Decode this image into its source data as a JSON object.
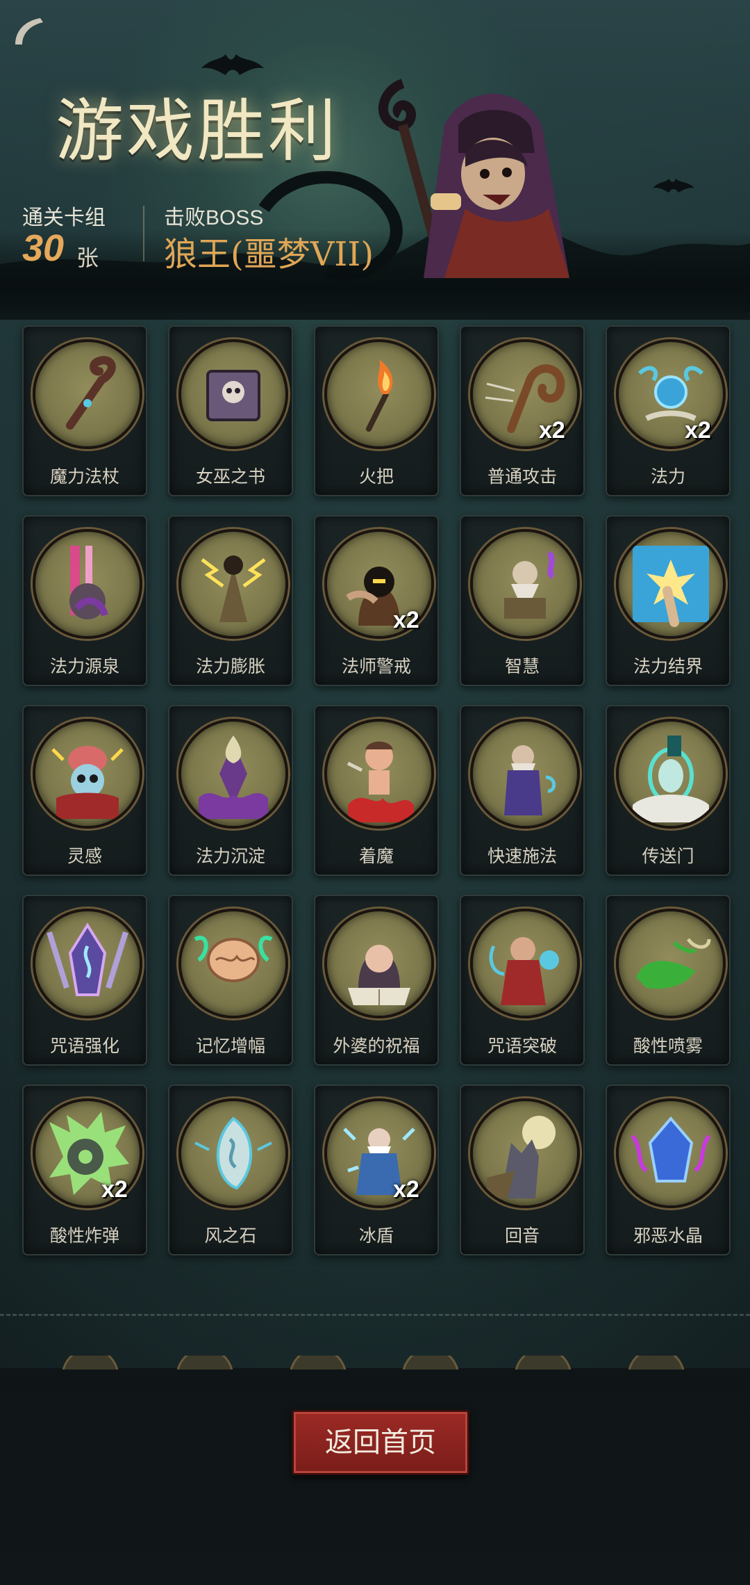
{
  "header": {
    "title": "游戏胜利",
    "cards_label": "通关卡组",
    "cards_count": "30",
    "cards_unit": "张",
    "boss_label": "击败BOSS",
    "boss_name": "狼王(噩梦VII)"
  },
  "cards": [
    {
      "name": "魔力法杖",
      "icon": "staff-icon",
      "count": ""
    },
    {
      "name": "女巫之书",
      "icon": "skull-book-icon",
      "count": ""
    },
    {
      "name": "火把",
      "icon": "torch-icon",
      "count": ""
    },
    {
      "name": "普通攻击",
      "icon": "crook-staff-icon",
      "count": "x2"
    },
    {
      "name": "法力",
      "icon": "mana-orb-icon",
      "count": "x2"
    },
    {
      "name": "法力源泉",
      "icon": "mana-fountain-icon",
      "count": ""
    },
    {
      "name": "法力膨胀",
      "icon": "lightning-mage-icon",
      "count": ""
    },
    {
      "name": "法师警戒",
      "icon": "hooded-mage-icon",
      "count": "x2"
    },
    {
      "name": "智慧",
      "icon": "wise-elder-icon",
      "count": ""
    },
    {
      "name": "法力结界",
      "icon": "barrier-hand-icon",
      "count": ""
    },
    {
      "name": "灵感",
      "icon": "brain-skull-icon",
      "count": ""
    },
    {
      "name": "法力沉淀",
      "icon": "purple-crystal-icon",
      "count": ""
    },
    {
      "name": "着魔",
      "icon": "possessed-icon",
      "count": ""
    },
    {
      "name": "快速施法",
      "icon": "wizard-icon",
      "count": ""
    },
    {
      "name": "传送门",
      "icon": "portal-icon",
      "count": ""
    },
    {
      "name": "咒语强化",
      "icon": "rune-crystal-icon",
      "count": ""
    },
    {
      "name": "记忆增幅",
      "icon": "brain-icon",
      "count": ""
    },
    {
      "name": "外婆的祝福",
      "icon": "grandma-icon",
      "count": ""
    },
    {
      "name": "咒语突破",
      "icon": "sorcerer-icon",
      "count": ""
    },
    {
      "name": "酸性喷雾",
      "icon": "acid-splash-icon",
      "count": ""
    },
    {
      "name": "酸性炸弹",
      "icon": "acid-bomb-icon",
      "count": "x2"
    },
    {
      "name": "风之石",
      "icon": "wind-stone-icon",
      "count": ""
    },
    {
      "name": "冰盾",
      "icon": "ice-wizard-icon",
      "count": "x2"
    },
    {
      "name": "回音",
      "icon": "werewolf-icon",
      "count": ""
    },
    {
      "name": "邪恶水晶",
      "icon": "evil-crystal-icon",
      "count": ""
    }
  ],
  "footer": {
    "home_button": "返回首页"
  },
  "colors": {
    "accent_gold": "#e0a656",
    "button_red": "#8a2420",
    "card_medal": "#7b774b"
  }
}
